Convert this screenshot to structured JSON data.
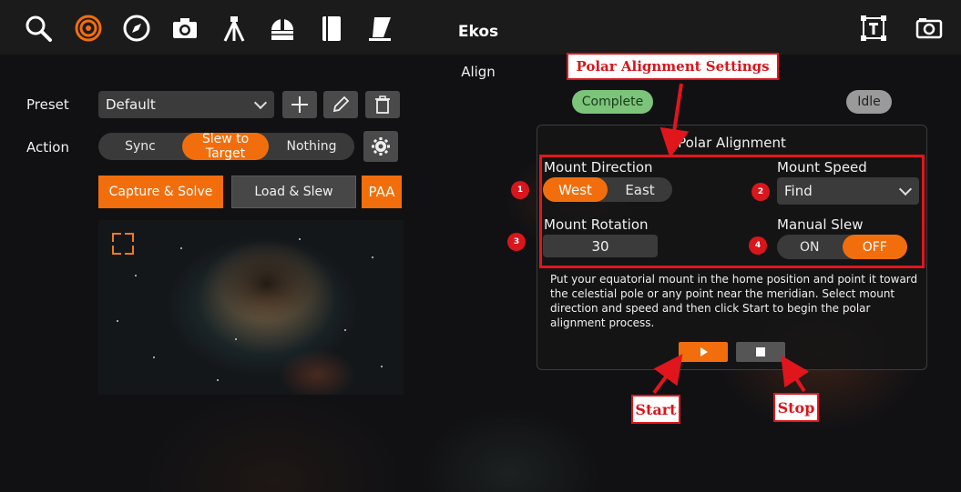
{
  "toolbar": {
    "title": "Ekos",
    "icons": [
      "search-icon",
      "target-icon",
      "compass-icon",
      "camera-icon",
      "tripod-icon",
      "observatory-icon",
      "notebook-icon",
      "scope-icon",
      "text-frame-icon",
      "screenshot-icon"
    ]
  },
  "module": {
    "name": "Align"
  },
  "left": {
    "preset_label": "Preset",
    "preset_value": "Default",
    "action_label": "Action",
    "action_options": [
      "Sync",
      "Slew to Target",
      "Nothing"
    ],
    "action_selected": "Slew to Target",
    "capture_solve": "Capture & Solve",
    "load_slew": "Load & Slew",
    "paa": "PAA"
  },
  "status": {
    "complete": "Complete",
    "idle": "Idle"
  },
  "polar": {
    "title": "Polar Alignment",
    "mount_direction_label": "Mount Direction",
    "direction_options": [
      "West",
      "East"
    ],
    "direction_selected": "West",
    "mount_speed_label": "Mount Speed",
    "mount_speed_value": "Find",
    "mount_rotation_label": "Mount Rotation",
    "mount_rotation_value": "30",
    "manual_slew_label": "Manual Slew",
    "manual_slew_options": [
      "ON",
      "OFF"
    ],
    "manual_slew_selected": "OFF",
    "description": "Put your equatorial mount in the home position and point it toward the celestial pole or any point near the meridian. Select mount direction and speed and then click Start to begin the polar alignment process."
  },
  "annotations": {
    "settings": "Polar Alignment Settings",
    "start": "Start",
    "stop": "Stop",
    "markers": [
      "1",
      "2",
      "3",
      "4"
    ]
  },
  "colors": {
    "accent": "#f26e0c",
    "annotation_red": "#e0161c",
    "complete_green": "#7cc47a",
    "idle_grey": "#9a9a9a"
  }
}
